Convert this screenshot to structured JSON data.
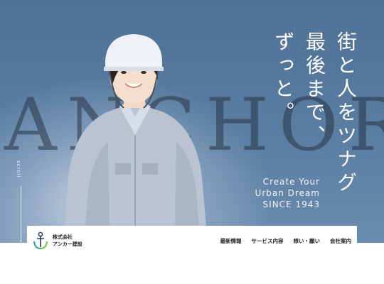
{
  "hero": {
    "watermark": "ANCHOR",
    "tagline_columns": [
      "街と人をツナグ",
      "最後まで、",
      "ずっと。"
    ],
    "sub_lines": [
      "Create Your",
      "Urban Dream",
      "SINCE 1943"
    ],
    "scroll_label": "scroll",
    "photo_alt": "笑顔の作業服の女性"
  },
  "header": {
    "logo_lines": [
      "株式会社",
      "アンカー建設"
    ],
    "nav": [
      "最新情報",
      "サービス内容",
      "想い・願い",
      "会社案内"
    ]
  },
  "colors": {
    "hero_blue": "#5a7da2",
    "logo_teal": "#3aa7a9",
    "logo_green": "#7cc04b",
    "logo_navy": "#1d3557"
  }
}
